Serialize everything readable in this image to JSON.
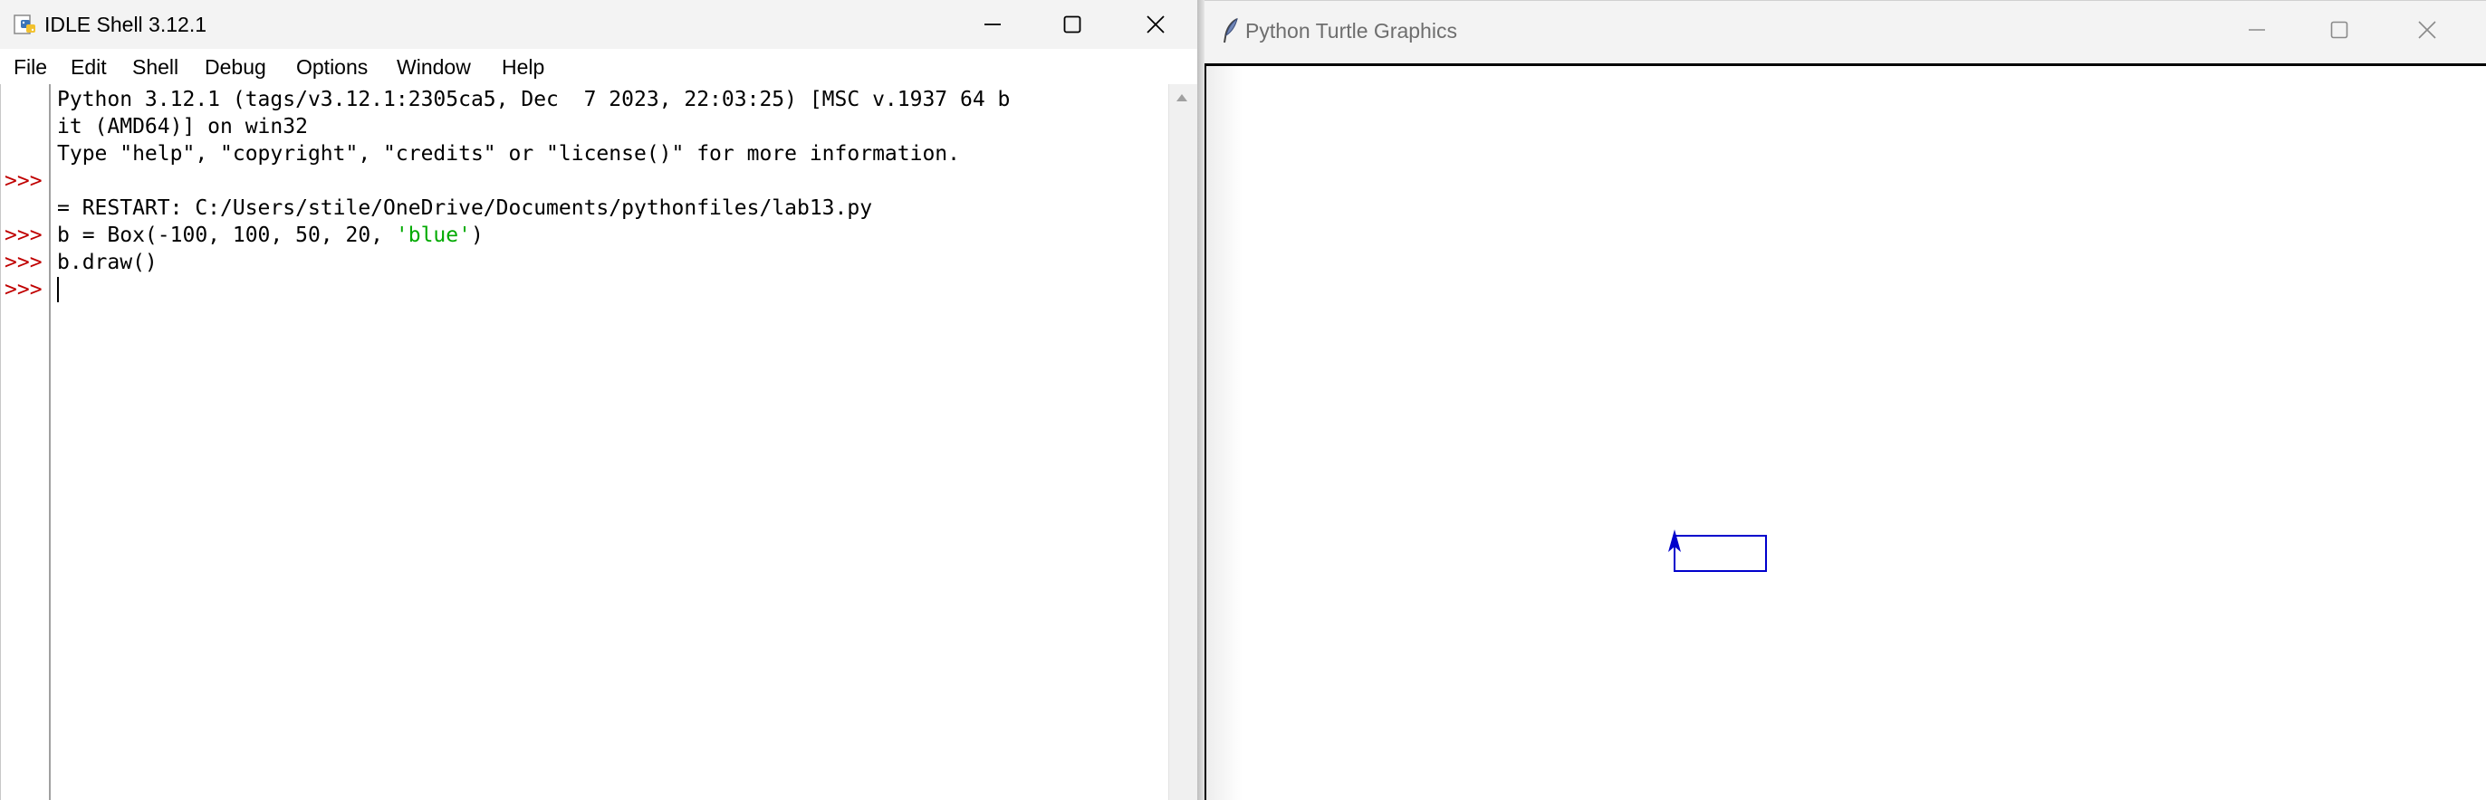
{
  "idle": {
    "title": "IDLE Shell 3.12.1",
    "menu": [
      "File",
      "Edit",
      "Shell",
      "Debug",
      "Options",
      "Window",
      "Help"
    ],
    "prompt": ">>>",
    "lines": {
      "banner1": "Python 3.12.1 (tags/v3.12.1:2305ca5, Dec  7 2023, 22:03:25) [MSC v.1937 64 b",
      "banner2": "it (AMD64)] on win32",
      "banner3": "Type \"help\", \"copyright\", \"credits\" or \"license()\" for more information.",
      "restart": "= RESTART: C:/Users/stile/OneDrive/Documents/pythonfiles/lab13.py",
      "cmd1_pre": "b = Box(-100, 100, 50, 20, ",
      "cmd1_str": "'blue'",
      "cmd1_post": ")",
      "cmd2": "b.draw()"
    },
    "icons": {
      "app": "python-idle-icon",
      "minimize": "minimize-icon",
      "maximize": "maximize-icon",
      "close": "close-icon",
      "scroll_up": "scroll-up-arrow-icon"
    }
  },
  "turtle": {
    "title": "Python Turtle Graphics",
    "icons": {
      "app": "feather-icon",
      "minimize": "minimize-icon",
      "maximize": "maximize-icon",
      "close": "close-icon",
      "turtle_cursor": "arrow-turtle-icon"
    },
    "drawing": {
      "shape": "rectangle",
      "color": "#0000cc"
    }
  },
  "colors": {
    "prompt": "#c00000",
    "string": "#00aa00"
  }
}
